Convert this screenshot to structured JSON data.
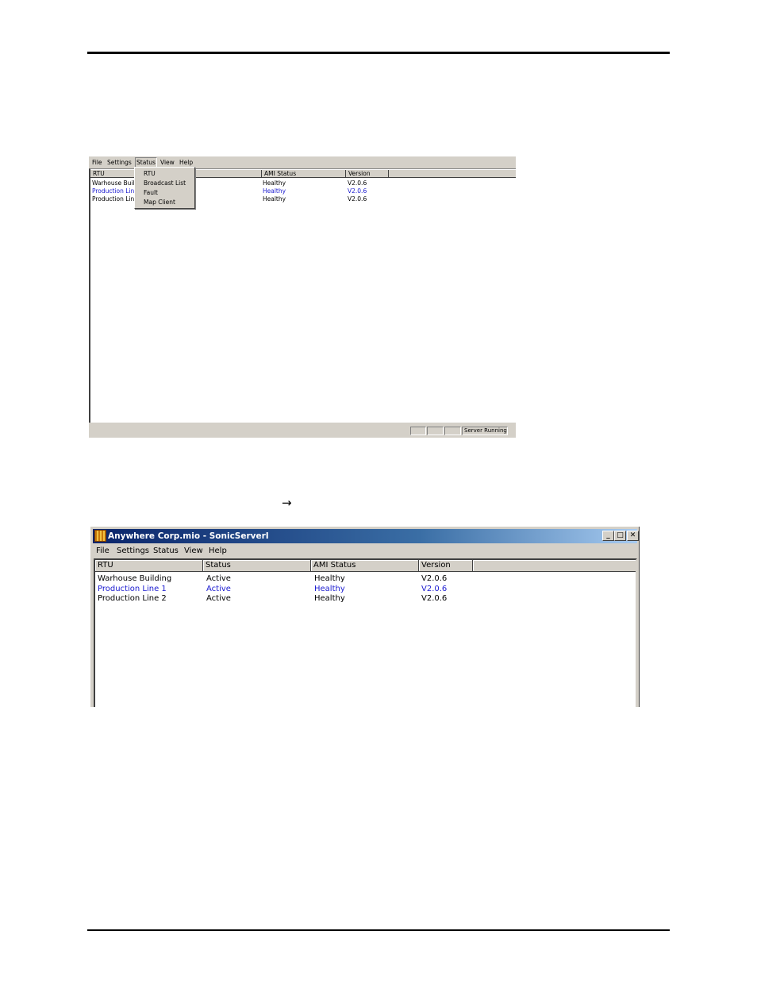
{
  "screenshot1": {
    "menu": [
      "File",
      "Settings",
      "Status",
      "View",
      "Help"
    ],
    "dropdown": [
      "RTU",
      "Broadcast List",
      "Fault",
      "Map Client"
    ],
    "columns": [
      "RTU",
      "AMI Status",
      "Version"
    ],
    "rows": [
      {
        "rtu": "Warhouse Build",
        "ami": "Healthy",
        "version": "V2.0.6"
      },
      {
        "rtu": "Production Line",
        "ami": "Healthy",
        "version": "V2.0.6"
      },
      {
        "rtu": "Production Line",
        "ami": "Healthy",
        "version": "V2.0.6"
      }
    ],
    "statusbar": "Server Running"
  },
  "arrow": "→",
  "screenshot2": {
    "title": "Anywhere Corp.mio - SonicServerI",
    "window_buttons": [
      "_",
      "□",
      "✕"
    ],
    "menu": [
      "File",
      "Settings",
      "Status",
      "View",
      "Help"
    ],
    "columns": [
      "RTU",
      "Status",
      "AMI Status",
      "Version"
    ],
    "rows": [
      {
        "rtu": "Warhouse Building",
        "status": "Active",
        "ami": "Healthy",
        "version": "V2.0.6"
      },
      {
        "rtu": "Production Line 1",
        "status": "Active",
        "ami": "Healthy",
        "version": "V2.0.6"
      },
      {
        "rtu": "Production Line 2",
        "status": "Active",
        "ami": "Healthy",
        "version": "V2.0.6"
      }
    ]
  }
}
